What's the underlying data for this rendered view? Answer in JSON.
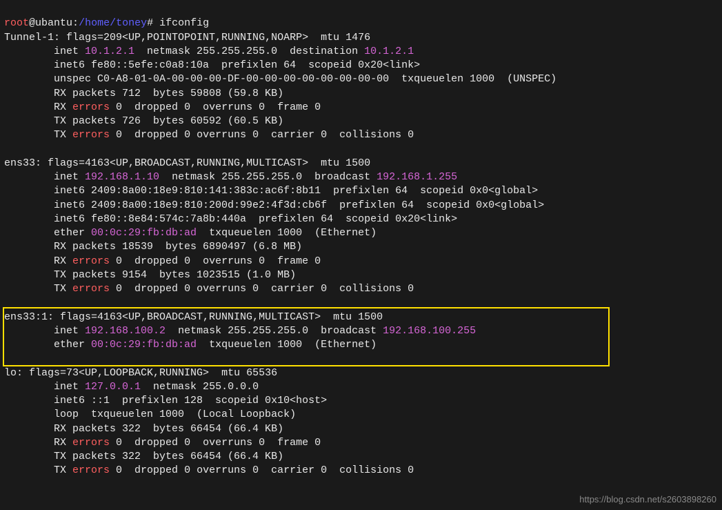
{
  "prompt": {
    "user": "root",
    "at": "@",
    "host": "ubantu",
    "colon": ":",
    "path": "/home/toney",
    "hash": "# ",
    "cmd": "ifconfig"
  },
  "tunnel": {
    "name": "Tunnel-1:",
    "flags": " flags=209<UP,POINTOPOINT,RUNNING,NOARP>  mtu 1476",
    "inet_lbl": "        inet ",
    "inet_ip": "10.1.2.1",
    "inet_mask": "  netmask 255.255.255.0  destination ",
    "dest_ip": "10.1.2.1",
    "inet6": "        inet6 fe80::5efe:c0a8:10a  prefixlen 64  scopeid 0x20<link>",
    "unspec": "        unspec C0-A8-01-0A-00-00-00-DF-00-00-00-00-00-00-00-00  txqueuelen 1000  (UNSPEC)",
    "rxp": "        RX packets 712  bytes 59808 (59.8 KB)",
    "rxe_pre": "        RX ",
    "rxe_err": "errors",
    "rxe_post": " 0  dropped 0  overruns 0  frame 0",
    "txp": "        TX packets 726  bytes 60592 (60.5 KB)",
    "txe_pre": "        TX ",
    "txe_err": "errors",
    "txe_post": " 0  dropped 0 overruns 0  carrier 0  collisions 0"
  },
  "ens33": {
    "name": "ens33:",
    "flags": " flags=4163<UP,BROADCAST,RUNNING,MULTICAST>  mtu 1500",
    "inet_lbl": "        inet ",
    "inet_ip": "192.168.1.10",
    "inet_mid": "  netmask 255.255.255.0  broadcast ",
    "bcast_ip": "192.168.1.255",
    "inet6a": "        inet6 2409:8a00:18e9:810:141:383c:ac6f:8b11  prefixlen 64  scopeid 0x0<global>",
    "inet6b": "        inet6 2409:8a00:18e9:810:200d:99e2:4f3d:cb6f  prefixlen 64  scopeid 0x0<global>",
    "inet6c": "        inet6 fe80::8e84:574c:7a8b:440a  prefixlen 64  scopeid 0x20<link>",
    "ether_lbl": "        ether ",
    "ether_mac": "00:0c:29:fb:db:ad",
    "ether_post": "  txqueuelen 1000  (Ethernet)",
    "rxp": "        RX packets 18539  bytes 6890497 (6.8 MB)",
    "rxe_pre": "        RX ",
    "rxe_err": "errors",
    "rxe_post": " 0  dropped 0  overruns 0  frame 0",
    "txp": "        TX packets 9154  bytes 1023515 (1.0 MB)",
    "txe_pre": "        TX ",
    "txe_err": "errors",
    "txe_post": " 0  dropped 0 overruns 0  carrier 0  collisions 0"
  },
  "ens33_1": {
    "name": "ens33:1:",
    "flags": " flags=4163<UP,BROADCAST,RUNNING,MULTICAST>  mtu 1500",
    "inet_lbl": "        inet ",
    "inet_ip": "192.168.100.2",
    "inet_mid": "  netmask 255.255.255.0  broadcast ",
    "bcast_ip": "192.168.100.255",
    "ether_lbl": "        ether ",
    "ether_mac": "00:0c:29:fb:db:ad",
    "ether_post": "  txqueuelen 1000  (Ethernet)"
  },
  "lo": {
    "name": "lo:",
    "flags": " flags=73<UP,LOOPBACK,RUNNING>  mtu 65536",
    "inet_lbl": "        inet ",
    "inet_ip": "127.0.0.1",
    "inet_mask": "  netmask 255.0.0.0",
    "inet6": "        inet6 ::1  prefixlen 128  scopeid 0x10<host>",
    "loop": "        loop  txqueuelen 1000  (Local Loopback)",
    "rxp": "        RX packets 322  bytes 66454 (66.4 KB)",
    "rxe_pre": "        RX ",
    "rxe_err": "errors",
    "rxe_post": " 0  dropped 0  overruns 0  frame 0",
    "txp": "        TX packets 322  bytes 66454 (66.4 KB)",
    "txe_pre": "        TX ",
    "txe_err": "errors",
    "txe_post": " 0  dropped 0 overruns 0  carrier 0  collisions 0"
  },
  "watermark": "https://blog.csdn.net/s2603898260"
}
